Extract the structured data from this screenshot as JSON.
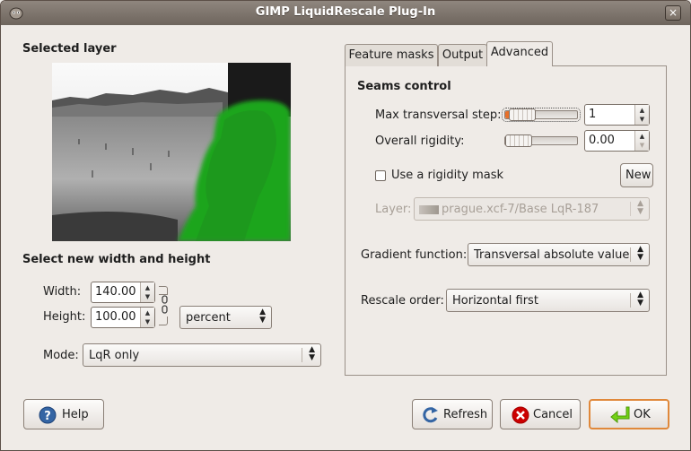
{
  "window": {
    "title": "GIMP LiquidRescale Plug-In",
    "close_glyph": "×"
  },
  "left": {
    "selected_layer_heading": "Selected layer",
    "size_heading": "Select new width and height",
    "width_label": "Width:",
    "width_value": "140.00",
    "height_label": "Height:",
    "height_value": "100.00",
    "unit_value": "percent",
    "mode_label": "Mode:",
    "mode_value": "LqR only"
  },
  "tabs": [
    {
      "label": "Feature masks"
    },
    {
      "label": "Output"
    },
    {
      "label": "Advanced",
      "active": true
    }
  ],
  "advanced": {
    "seams_heading": "Seams control",
    "max_step_label": "Max transversal step:",
    "max_step_value": "1",
    "max_step_level": 0.0,
    "rigidity_label": "Overall rigidity:",
    "rigidity_value": "0.00",
    "rigidity_level": 0.0,
    "rigidity_mask_label": "Use a rigidity mask",
    "rigidity_mask_checked": false,
    "new_button": "New",
    "layer_label": "Layer:",
    "layer_value": "prague.xcf-7/Base LqR-187",
    "gradient_label": "Gradient function:",
    "gradient_value": "Transversal absolute value",
    "rescale_label": "Rescale order:",
    "rescale_value": "Horizontal first"
  },
  "buttons": {
    "help": "Help",
    "refresh": "Refresh",
    "cancel": "Cancel",
    "ok": "OK"
  },
  "colors": {
    "accent": "#e8702a",
    "mask_green": "#1fa51f",
    "ok_border": "#e0883a"
  }
}
